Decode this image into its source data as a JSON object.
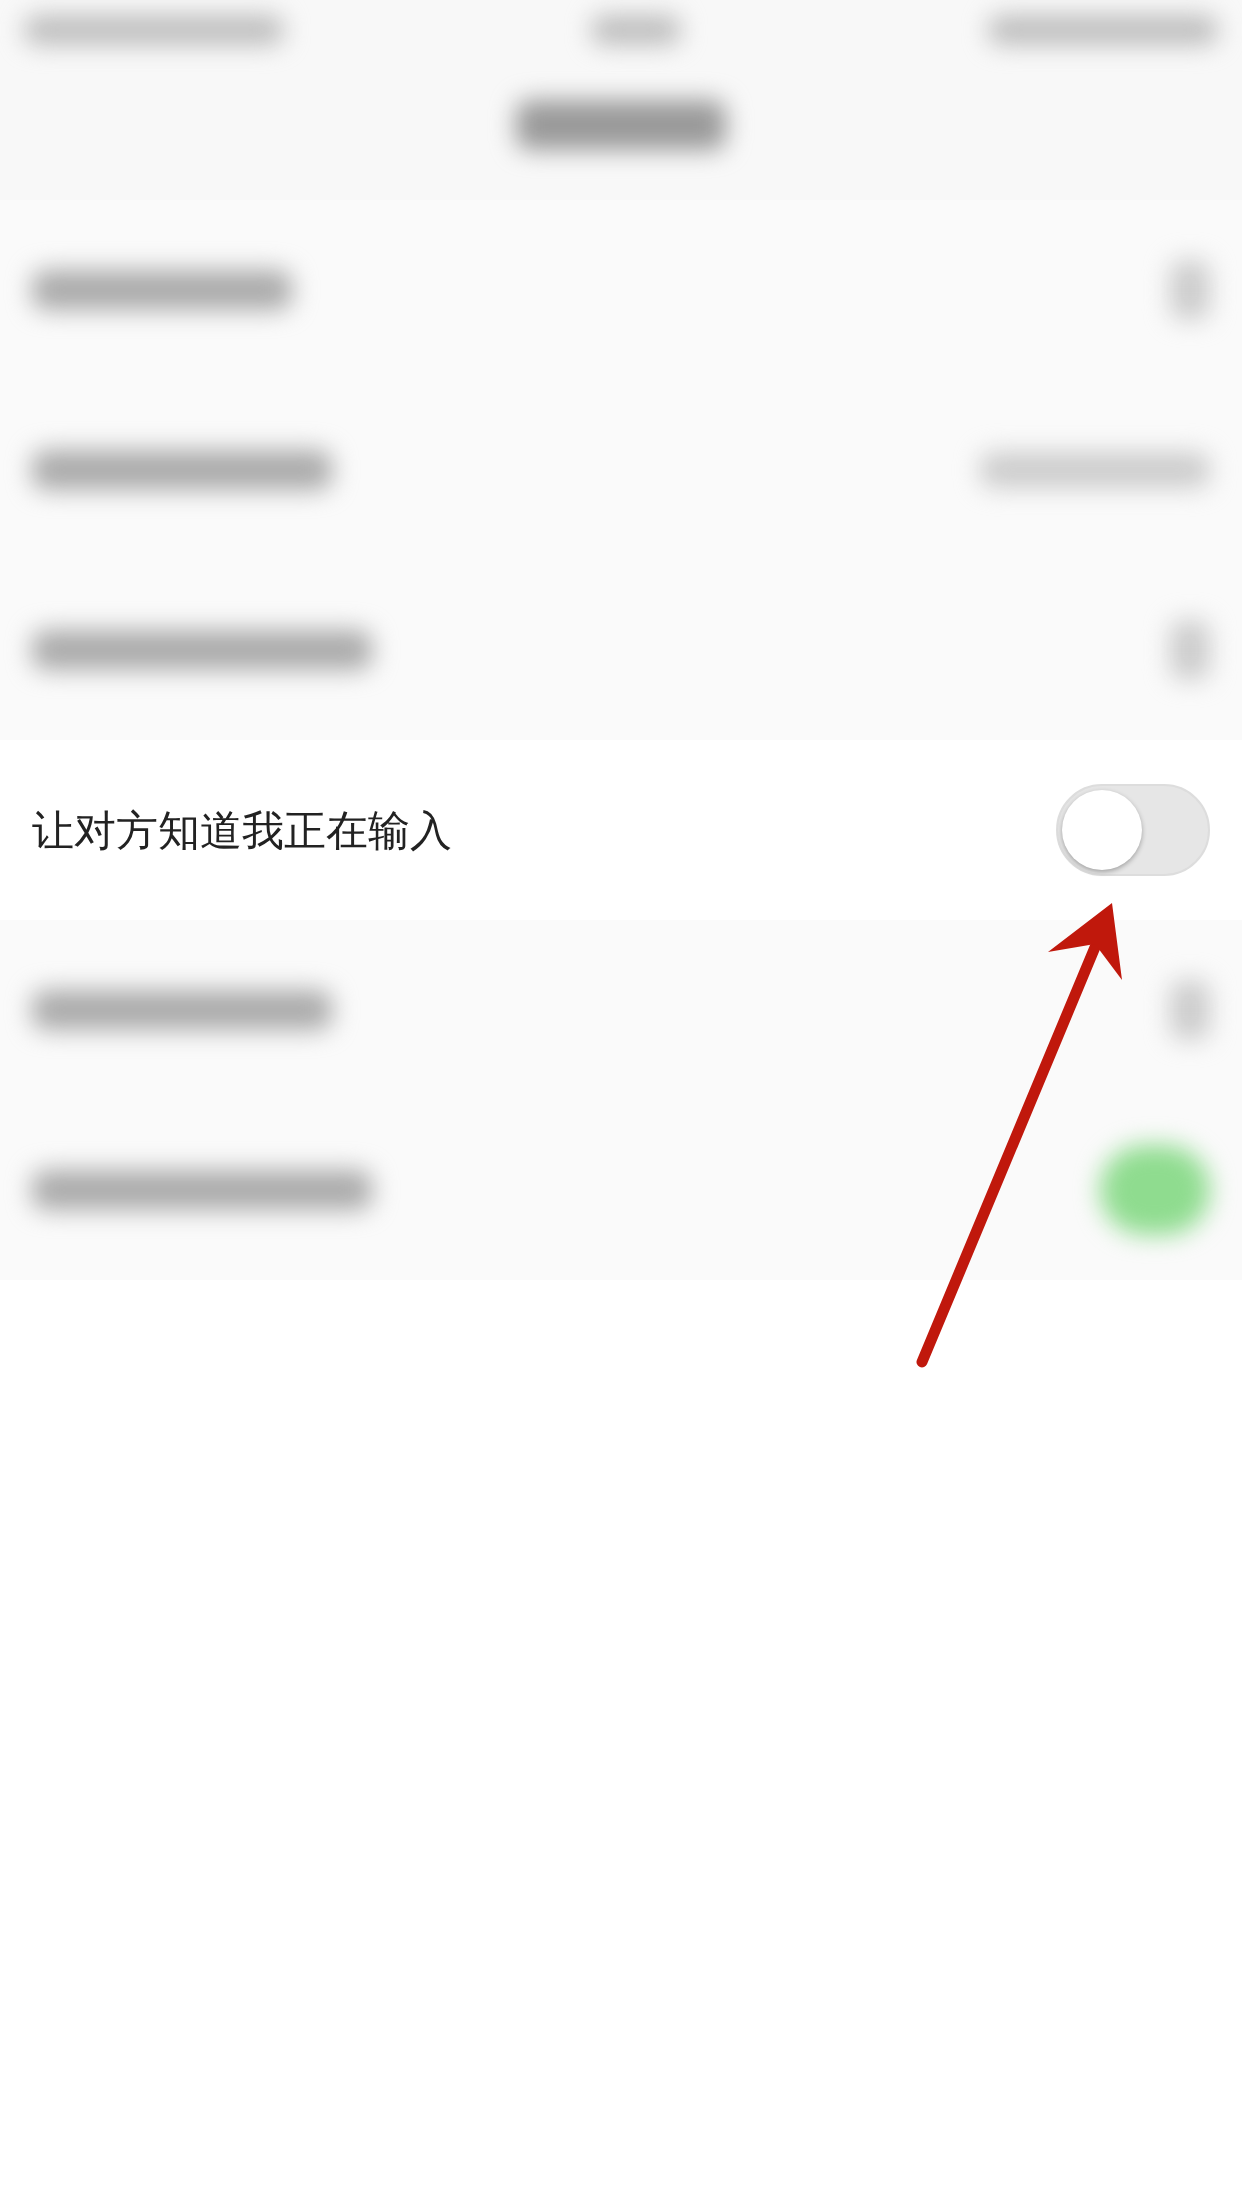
{
  "header": {
    "kind": "blurred"
  },
  "rows": [
    {
      "kind": "blurred",
      "trailing": {
        "kind": "chevron"
      }
    },
    {
      "kind": "blurred",
      "trailing": {
        "kind": "value"
      }
    },
    {
      "kind": "blurred",
      "trailing": {
        "kind": "chevron"
      }
    },
    {
      "kind": "toggle",
      "label": "让对方知道我正在输入",
      "on": false
    },
    {
      "kind": "blurred",
      "trailing": {
        "kind": "chevron"
      }
    },
    {
      "kind": "blurred",
      "trailing": {
        "kind": "switch",
        "on": true
      }
    }
  ],
  "annotation": {
    "kind": "arrow"
  }
}
